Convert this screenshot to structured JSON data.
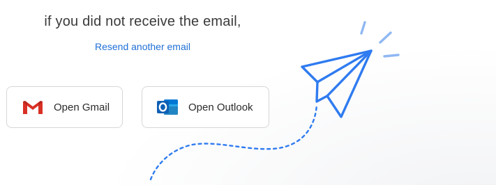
{
  "message": "if you did not receive the email,",
  "resend_link": "Resend another email",
  "buttons": {
    "gmail": {
      "label": "Open Gmail",
      "icon": "gmail-icon"
    },
    "outlook": {
      "label": "Open Outlook",
      "icon": "outlook-icon"
    }
  },
  "illustration": {
    "icon": "paper-plane-icon"
  },
  "colors": {
    "accent": "#1f6fd6",
    "plane": "#2f7bf0",
    "sparks": "#8fb8f3"
  }
}
